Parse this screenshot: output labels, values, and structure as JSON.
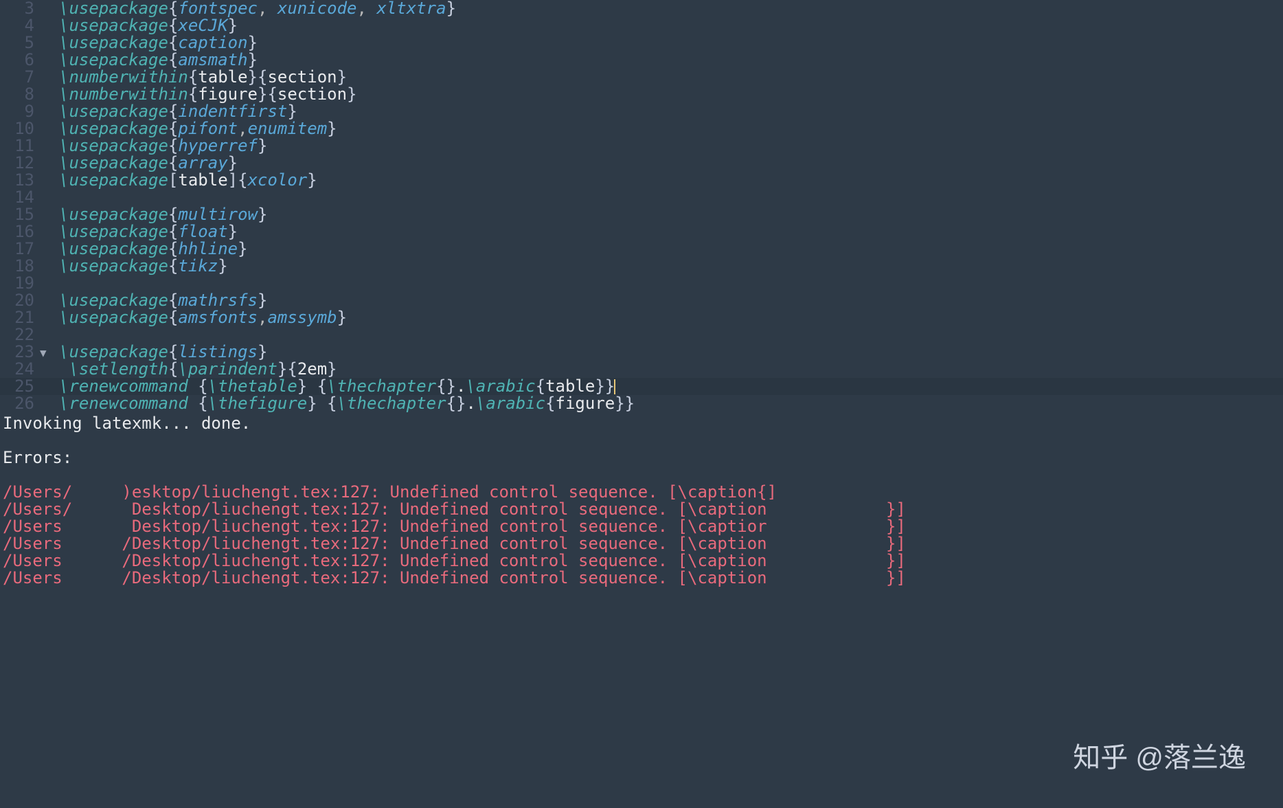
{
  "editor": {
    "lines": [
      {
        "num": "3",
        "fold": "",
        "tokens": [
          {
            "c": "cmd",
            "t": "\\usepackage"
          },
          {
            "c": "brace",
            "t": "{"
          },
          {
            "c": "arg",
            "t": "fontspec"
          },
          {
            "c": "comma",
            "t": ", "
          },
          {
            "c": "arg",
            "t": "xunicode"
          },
          {
            "c": "comma",
            "t": ", "
          },
          {
            "c": "arg",
            "t": "xltxtra"
          },
          {
            "c": "brace",
            "t": "}"
          }
        ]
      },
      {
        "num": "4",
        "fold": "",
        "tokens": [
          {
            "c": "cmd",
            "t": "\\usepackage"
          },
          {
            "c": "brace",
            "t": "{"
          },
          {
            "c": "arg",
            "t": "xeCJK"
          },
          {
            "c": "brace",
            "t": "}"
          }
        ]
      },
      {
        "num": "5",
        "fold": "",
        "tokens": [
          {
            "c": "cmd",
            "t": "\\usepackage"
          },
          {
            "c": "brace",
            "t": "{"
          },
          {
            "c": "arg",
            "t": "caption"
          },
          {
            "c": "brace",
            "t": "}"
          }
        ]
      },
      {
        "num": "6",
        "fold": "",
        "tokens": [
          {
            "c": "cmd",
            "t": "\\usepackage"
          },
          {
            "c": "brace",
            "t": "{"
          },
          {
            "c": "arg",
            "t": "amsmath"
          },
          {
            "c": "brace",
            "t": "}"
          }
        ]
      },
      {
        "num": "7",
        "fold": "",
        "tokens": [
          {
            "c": "cmd",
            "t": "\\numberwithin"
          },
          {
            "c": "brace",
            "t": "{"
          },
          {
            "c": "plain",
            "t": "table"
          },
          {
            "c": "brace",
            "t": "}{"
          },
          {
            "c": "plain",
            "t": "section"
          },
          {
            "c": "brace",
            "t": "}"
          }
        ]
      },
      {
        "num": "8",
        "fold": "",
        "tokens": [
          {
            "c": "cmd",
            "t": "\\numberwithin"
          },
          {
            "c": "brace",
            "t": "{"
          },
          {
            "c": "plain",
            "t": "figure"
          },
          {
            "c": "brace",
            "t": "}{"
          },
          {
            "c": "plain",
            "t": "section"
          },
          {
            "c": "brace",
            "t": "}"
          }
        ]
      },
      {
        "num": "9",
        "fold": "",
        "tokens": [
          {
            "c": "cmd",
            "t": "\\usepackage"
          },
          {
            "c": "brace",
            "t": "{"
          },
          {
            "c": "arg",
            "t": "indentfirst"
          },
          {
            "c": "brace",
            "t": "}"
          }
        ]
      },
      {
        "num": "10",
        "fold": "",
        "tokens": [
          {
            "c": "cmd",
            "t": "\\usepackage"
          },
          {
            "c": "brace",
            "t": "{"
          },
          {
            "c": "arg",
            "t": "pifont"
          },
          {
            "c": "comma",
            "t": ","
          },
          {
            "c": "arg",
            "t": "enumitem"
          },
          {
            "c": "brace",
            "t": "}"
          }
        ]
      },
      {
        "num": "11",
        "fold": "",
        "tokens": [
          {
            "c": "cmd",
            "t": "\\usepackage"
          },
          {
            "c": "brace",
            "t": "{"
          },
          {
            "c": "arg",
            "t": "hyperref"
          },
          {
            "c": "brace",
            "t": "}"
          }
        ]
      },
      {
        "num": "12",
        "fold": "",
        "tokens": [
          {
            "c": "cmd",
            "t": "\\usepackage"
          },
          {
            "c": "brace",
            "t": "{"
          },
          {
            "c": "arg",
            "t": "array"
          },
          {
            "c": "brace",
            "t": "}"
          }
        ]
      },
      {
        "num": "13",
        "fold": "",
        "tokens": [
          {
            "c": "cmd",
            "t": "\\usepackage"
          },
          {
            "c": "brace",
            "t": "["
          },
          {
            "c": "plain",
            "t": "table"
          },
          {
            "c": "brace",
            "t": "]{"
          },
          {
            "c": "arg",
            "t": "xcolor"
          },
          {
            "c": "brace",
            "t": "}"
          }
        ]
      },
      {
        "num": "14",
        "fold": "",
        "tokens": []
      },
      {
        "num": "15",
        "fold": "",
        "tokens": [
          {
            "c": "cmd",
            "t": "\\usepackage"
          },
          {
            "c": "brace",
            "t": "{"
          },
          {
            "c": "arg",
            "t": "multirow"
          },
          {
            "c": "brace",
            "t": "}"
          }
        ]
      },
      {
        "num": "16",
        "fold": "",
        "tokens": [
          {
            "c": "cmd",
            "t": "\\usepackage"
          },
          {
            "c": "brace",
            "t": "{"
          },
          {
            "c": "arg",
            "t": "float"
          },
          {
            "c": "brace",
            "t": "}"
          }
        ]
      },
      {
        "num": "17",
        "fold": "",
        "tokens": [
          {
            "c": "cmd",
            "t": "\\usepackage"
          },
          {
            "c": "brace",
            "t": "{"
          },
          {
            "c": "arg",
            "t": "hhline"
          },
          {
            "c": "brace",
            "t": "}"
          }
        ]
      },
      {
        "num": "18",
        "fold": "",
        "tokens": [
          {
            "c": "cmd",
            "t": "\\usepackage"
          },
          {
            "c": "brace",
            "t": "{"
          },
          {
            "c": "arg",
            "t": "tikz"
          },
          {
            "c": "brace",
            "t": "}"
          }
        ]
      },
      {
        "num": "19",
        "fold": "",
        "tokens": []
      },
      {
        "num": "20",
        "fold": "",
        "tokens": [
          {
            "c": "cmd",
            "t": "\\usepackage"
          },
          {
            "c": "brace",
            "t": "{"
          },
          {
            "c": "arg",
            "t": "mathrsfs"
          },
          {
            "c": "brace",
            "t": "}"
          }
        ]
      },
      {
        "num": "21",
        "fold": "",
        "tokens": [
          {
            "c": "cmd",
            "t": "\\usepackage"
          },
          {
            "c": "brace",
            "t": "{"
          },
          {
            "c": "arg",
            "t": "amsfonts"
          },
          {
            "c": "comma",
            "t": ","
          },
          {
            "c": "arg",
            "t": "amssymb"
          },
          {
            "c": "brace",
            "t": "}"
          }
        ]
      },
      {
        "num": "22",
        "fold": "",
        "tokens": []
      },
      {
        "num": "23",
        "fold": "▼",
        "tokens": [
          {
            "c": "cmd",
            "t": "\\usepackage"
          },
          {
            "c": "brace",
            "t": "{"
          },
          {
            "c": "arg",
            "t": "listings"
          },
          {
            "c": "brace",
            "t": "}"
          }
        ]
      },
      {
        "num": "24",
        "fold": "",
        "tokens": [
          {
            "c": "cmd",
            "t": " \\setlength"
          },
          {
            "c": "brace",
            "t": "{"
          },
          {
            "c": "cmd",
            "t": "\\parindent"
          },
          {
            "c": "brace",
            "t": "}{"
          },
          {
            "c": "plain",
            "t": "2em"
          },
          {
            "c": "brace",
            "t": "}"
          }
        ]
      },
      {
        "num": "25",
        "fold": "",
        "current": true,
        "tokens": [
          {
            "c": "cmd",
            "t": "\\renewcommand "
          },
          {
            "c": "brace",
            "t": "{"
          },
          {
            "c": "cmd",
            "t": "\\thetable"
          },
          {
            "c": "brace",
            "t": "} {"
          },
          {
            "c": "cmd",
            "t": "\\thechapter"
          },
          {
            "c": "brace",
            "t": "{}"
          },
          {
            "c": "plain",
            "t": "."
          },
          {
            "c": "cmd",
            "t": "\\arabic"
          },
          {
            "c": "brace",
            "t": "{"
          },
          {
            "c": "plain",
            "t": "table"
          },
          {
            "c": "brace",
            "t": "}}"
          }
        ],
        "cursor": true
      },
      {
        "num": "26",
        "fold": "",
        "tokens": [
          {
            "c": "cmd",
            "t": "\\renewcommand "
          },
          {
            "c": "brace",
            "t": "{"
          },
          {
            "c": "cmd",
            "t": "\\thefigure"
          },
          {
            "c": "brace",
            "t": "} {"
          },
          {
            "c": "cmd",
            "t": "\\thechapter"
          },
          {
            "c": "brace",
            "t": "{}"
          },
          {
            "c": "plain",
            "t": "."
          },
          {
            "c": "cmd",
            "t": "\\arabic"
          },
          {
            "c": "brace",
            "t": "{"
          },
          {
            "c": "plain",
            "t": "figure"
          },
          {
            "c": "brace",
            "t": "}}"
          }
        ]
      }
    ]
  },
  "terminal": {
    "status": "Invoking latexmk... done.",
    "errors_label": "Errors:",
    "errors": [
      "/Users/     )esktop/liuchengt.tex:127: Undefined control sequence. [\\caption{]",
      "/Users/      Desktop/liuchengt.tex:127: Undefined control sequence. [\\caption            }]",
      "/Users       Desktop/liuchengt.tex:127: Undefined control sequence. [\\captior            }]",
      "/Users      /Desktop/liuchengt.tex:127: Undefined control sequence. [\\caption            }]",
      "/Users      /Desktop/liuchengt.tex:127: Undefined control sequence. [\\caption            }]",
      "/Users      /Desktop/liuchengt.tex:127: Undefined control sequence. [\\caption            }]"
    ]
  },
  "watermark": "知乎 @落兰逸"
}
